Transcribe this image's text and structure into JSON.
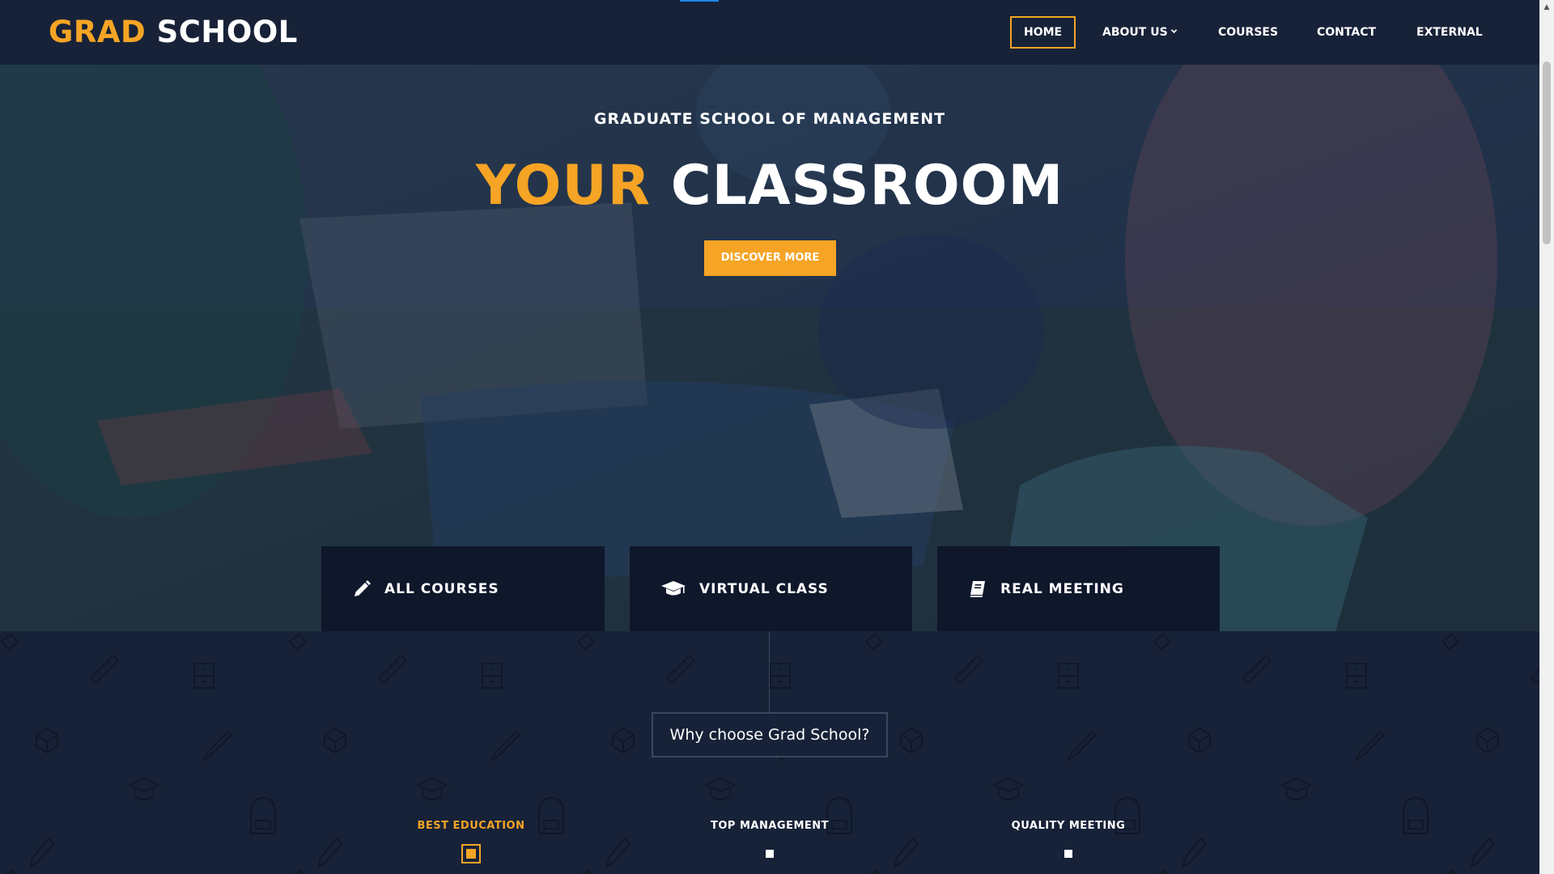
{
  "logo": {
    "accent": "GRAD",
    "rest": "SCHOOL"
  },
  "nav": {
    "items": [
      {
        "label": "HOME",
        "active": true
      },
      {
        "label": "ABOUT US",
        "dropdown": true
      },
      {
        "label": "COURSES"
      },
      {
        "label": "CONTACT"
      },
      {
        "label": "EXTERNAL"
      }
    ]
  },
  "hero": {
    "subtitle": "GRADUATE SCHOOL OF MANAGEMENT",
    "title_accent": "YOUR",
    "title_rest": "CLASSROOM",
    "button_label": "DISCOVER MORE"
  },
  "features": [
    {
      "label": "ALL COURSES",
      "icon": "pencil-icon"
    },
    {
      "label": "VIRTUAL CLASS",
      "icon": "graduation-cap-icon"
    },
    {
      "label": "REAL MEETING",
      "icon": "book-icon"
    }
  ],
  "section": {
    "heading": "Why choose Grad School?",
    "tabs": [
      {
        "label": "BEST EDUCATION",
        "active": true
      },
      {
        "label": "TOP MANAGEMENT"
      },
      {
        "label": "QUALITY MEETING"
      }
    ]
  },
  "colors": {
    "accent": "#f5a425",
    "navy": "#172238",
    "dark_box": "#0f172b"
  }
}
